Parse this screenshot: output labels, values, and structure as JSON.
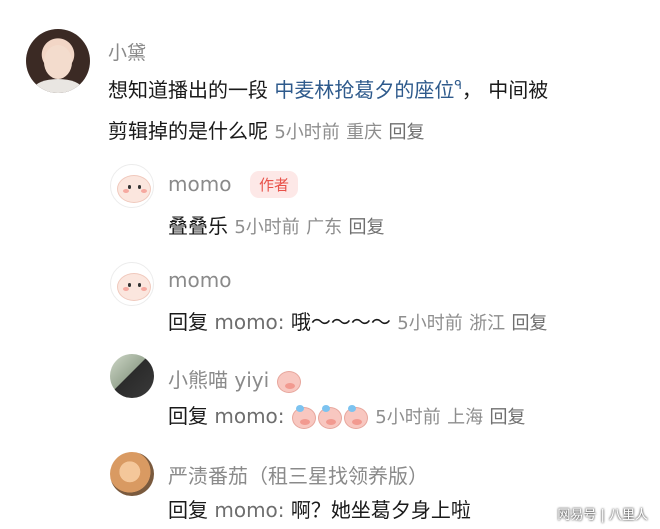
{
  "main_comment": {
    "author": "小黛",
    "text_part1": "想知道播出的一段",
    "link_text": "中麦林抢葛夕的座位",
    "search_glyph": "ᑫ",
    "text_part2": "，  中间被",
    "line2": "剪辑掉的是什么呢",
    "time": "5小时前",
    "location": "重庆",
    "reply_label": "回复"
  },
  "replies": [
    {
      "author": "momo",
      "badge": "作者",
      "text": "叠叠乐",
      "time": "5小时前",
      "location": "广东",
      "reply_label": "回复"
    },
    {
      "author": "momo",
      "reply_prefix": "回复",
      "mention": "momo:",
      "text": "哦～～～～",
      "time": "5小时前",
      "location": "浙江",
      "reply_label": "回复"
    },
    {
      "author": "小熊喵 yiyi",
      "author_emoji": "pig-face-icon",
      "reply_prefix": "回复",
      "mention": "momo:",
      "text_emoji": [
        "pig-sweat-icon",
        "pig-sweat-icon",
        "pig-sweat-icon"
      ],
      "time": "5小时前",
      "location": "上海",
      "reply_label": "回复"
    },
    {
      "author": "严渍番茄（租三星找领养版）",
      "reply_prefix": "回复",
      "mention": "momo:",
      "text": "啊？她坐葛夕身上啦"
    }
  ],
  "watermark": "网易号 | 八里人",
  "colors": {
    "link": "#2e5a8c",
    "badge_bg": "#fde8e7",
    "badge_text": "#e8524a",
    "meta": "#8e8e8e"
  }
}
